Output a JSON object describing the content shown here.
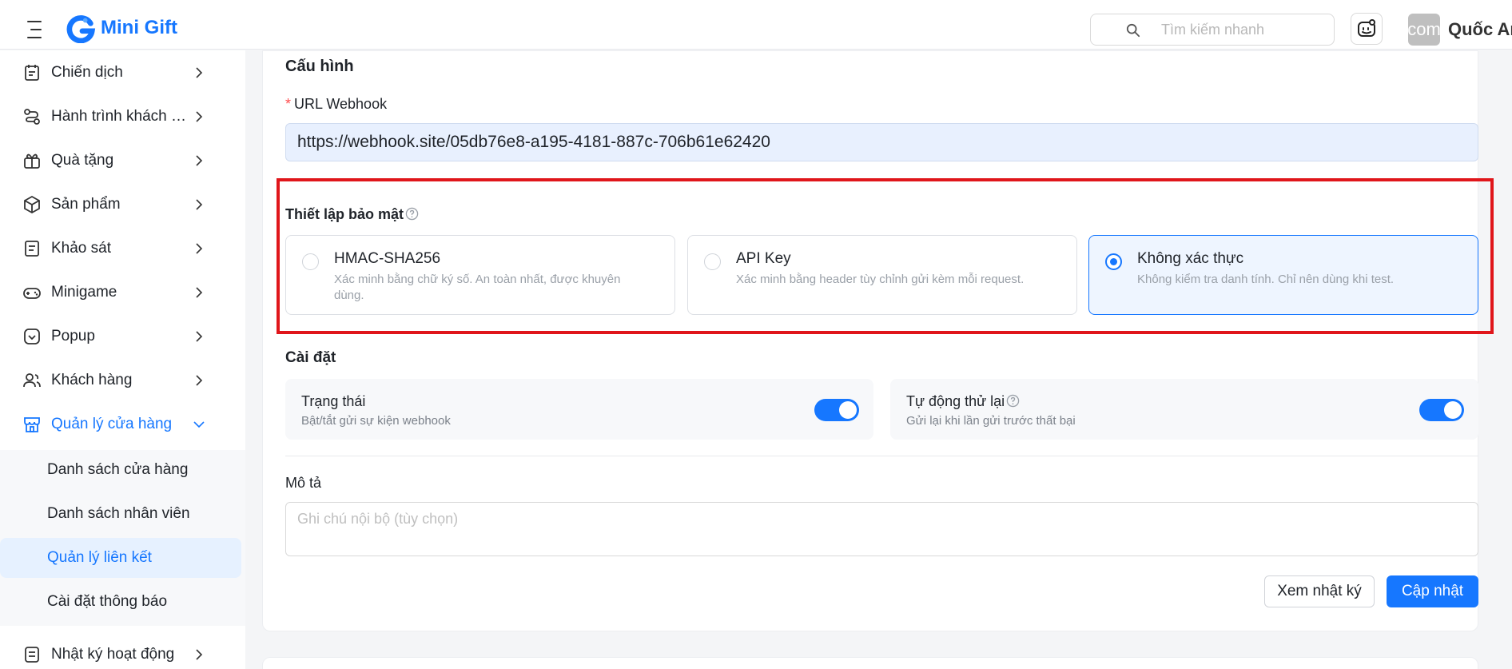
{
  "app": {
    "logo_text": "Mini Gift",
    "brand_color": "#1677ff"
  },
  "header": {
    "search_placeholder": "Tìm kiếm nhanh",
    "avatar_text": "com",
    "user_name": "Quốc Anh"
  },
  "sidebar": {
    "items": [
      {
        "label": "Chiến dịch",
        "icon": "calendar-icon"
      },
      {
        "label": "Hành trình khách hàng",
        "icon": "journey-icon"
      },
      {
        "label": "Quà tặng",
        "icon": "gift-icon"
      },
      {
        "label": "Sản phẩm",
        "icon": "box-icon"
      },
      {
        "label": "Khảo sát",
        "icon": "survey-icon"
      },
      {
        "label": "Minigame",
        "icon": "gamepad-icon"
      },
      {
        "label": "Popup",
        "icon": "popup-icon"
      },
      {
        "label": "Khách hàng",
        "icon": "users-icon"
      },
      {
        "label": "Quản lý cửa hàng",
        "icon": "store-icon",
        "expanded": true
      },
      {
        "label": "Nhật ký hoạt động",
        "icon": "log-icon"
      }
    ],
    "sub_items": [
      {
        "label": "Danh sách cửa hàng"
      },
      {
        "label": "Danh sách nhân viên"
      },
      {
        "label": "Quản lý liên kết",
        "active": true
      },
      {
        "label": "Cài đặt thông báo"
      }
    ]
  },
  "main": {
    "config_title": "Cấu hình",
    "url_label": "URL Webhook",
    "url_value": "https://webhook.site/05db76e8-a195-4181-887c-706b61e62420",
    "security_title": "Thiết lập bảo mật",
    "security_options": [
      {
        "title": "HMAC-SHA256",
        "desc": "Xác minh bằng chữ ký số. An toàn nhất, được khuyên dùng.",
        "selected": false
      },
      {
        "title": "API Key",
        "desc": "Xác minh bằng header tùy chỉnh gửi kèm mỗi request.",
        "selected": false
      },
      {
        "title": "Không xác thực",
        "desc": "Không kiểm tra danh tính. Chỉ nên dùng khi test.",
        "selected": true
      }
    ],
    "settings_title": "Cài đặt",
    "settings": [
      {
        "title": "Trạng thái",
        "desc": "Bật/tắt gửi sự kiện webhook",
        "enabled": true
      },
      {
        "title": "Tự động thử lại",
        "desc": "Gửi lại khi lần gửi trước thất bại",
        "enabled": true
      }
    ],
    "description_label": "Mô tả",
    "description_placeholder": "Ghi chú nội bộ (tùy chọn)",
    "description_value": "",
    "view_log_label": "Xem nhật ký",
    "update_label": "Cập nhật"
  },
  "colors": {
    "highlight_border": "#e0161b",
    "toggle_on": "#1677ff"
  }
}
